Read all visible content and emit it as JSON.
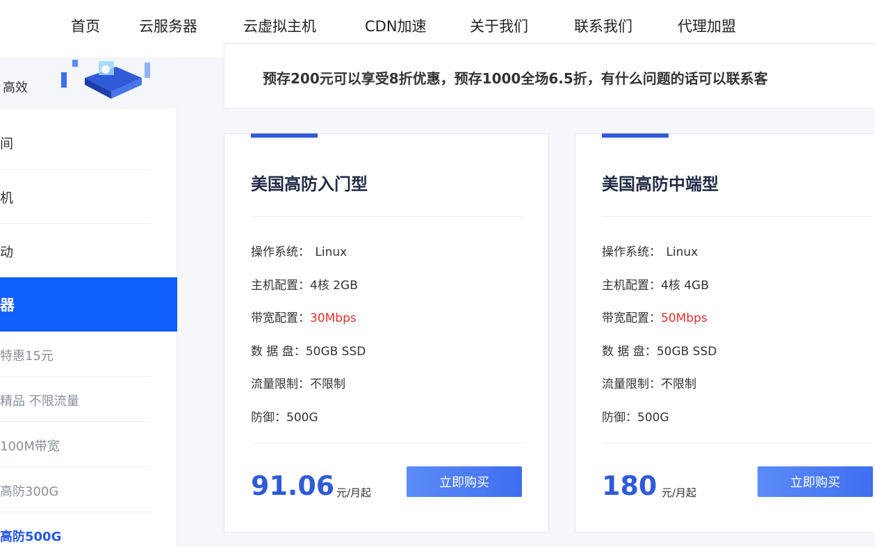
{
  "nav": {
    "items": [
      "首页",
      "云服务器",
      "云虚拟主机",
      "CDN加速",
      "关于我们",
      "联系我们",
      "代理加盟"
    ]
  },
  "sidebar": {
    "banner_text": "高效",
    "items": [
      "间",
      "机",
      "动"
    ],
    "active_label": "器",
    "sub_items": [
      "特惠15元",
      "精品 不限流量",
      "100M带宽",
      "高防300G",
      "高防500G"
    ]
  },
  "notice": {
    "text": "预存200元可以享受8折优惠，预存1000全场6.5折，有什么问题的话可以联系客"
  },
  "products": [
    {
      "title": "美国高防入门型",
      "os_label": "操作系统：",
      "os_value": "Linux",
      "cfg_label": "主机配置：",
      "cfg_value": "4核 2GB",
      "bw_label": "带宽配置：",
      "bw_value": "30Mbps",
      "disk_label": "数 据 盘：",
      "disk_value": "50GB SSD",
      "traffic_label": "流量限制：",
      "traffic_value": "不限制",
      "defense": "防御：500G",
      "price": "91.06",
      "unit": "元/月起",
      "buy_label": "立即购买"
    },
    {
      "title": "美国高防中端型",
      "os_label": "操作系统：",
      "os_value": "Linux",
      "cfg_label": "主机配置：",
      "cfg_value": "4核 4GB",
      "bw_label": "带宽配置：",
      "bw_value": "50Mbps",
      "disk_label": "数 据 盘：",
      "disk_value": "50GB SSD",
      "traffic_label": "流量限制：",
      "traffic_value": "不限制",
      "defense": "防御：500G",
      "price": "180",
      "unit": "元/月起",
      "buy_label": "立即购买"
    }
  ],
  "colors": {
    "primary": "#2f5bd8",
    "active_bg": "#0f5eff",
    "highlight_red": "#e0322b"
  }
}
